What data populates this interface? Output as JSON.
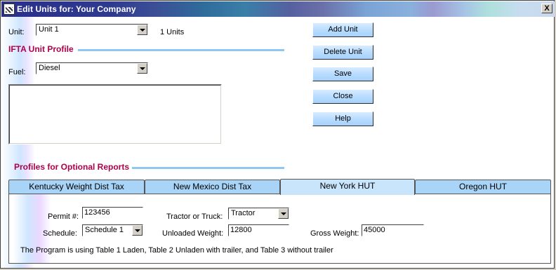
{
  "window": {
    "title": "Edit Units for: Your Company",
    "close_label": "X"
  },
  "unit": {
    "label": "Unit:",
    "value": "Unit 1",
    "count_text": "1 Units"
  },
  "ifta": {
    "heading": "IFTA Unit Profile",
    "fuel_label": "Fuel:",
    "fuel_value": "Diesel"
  },
  "buttons": {
    "add": "Add Unit",
    "delete": "Delete Unit",
    "save": "Save",
    "close": "Close",
    "help": "Help"
  },
  "optional": {
    "heading": "Profiles for Optional Reports"
  },
  "tabs": [
    {
      "label": "Kentucky Weight Dist Tax"
    },
    {
      "label": "New Mexico Dist Tax"
    },
    {
      "label": "New York HUT"
    },
    {
      "label": "Oregon  HUT"
    }
  ],
  "ny": {
    "permit_label": "Permit #:",
    "permit_value": "123456",
    "schedule_label": "Schedule:",
    "schedule_value": "Schedule 1",
    "tractor_label": "Tractor or Truck:",
    "tractor_value": "Tractor",
    "unloaded_label": "Unloaded Weight:",
    "unloaded_value": "12800",
    "gross_label": "Gross Weight:",
    "gross_value": "45000",
    "note": "The Program is using Table 1 Laden, Table 2 Unladen with trailer, and Table 3 without trailer"
  }
}
